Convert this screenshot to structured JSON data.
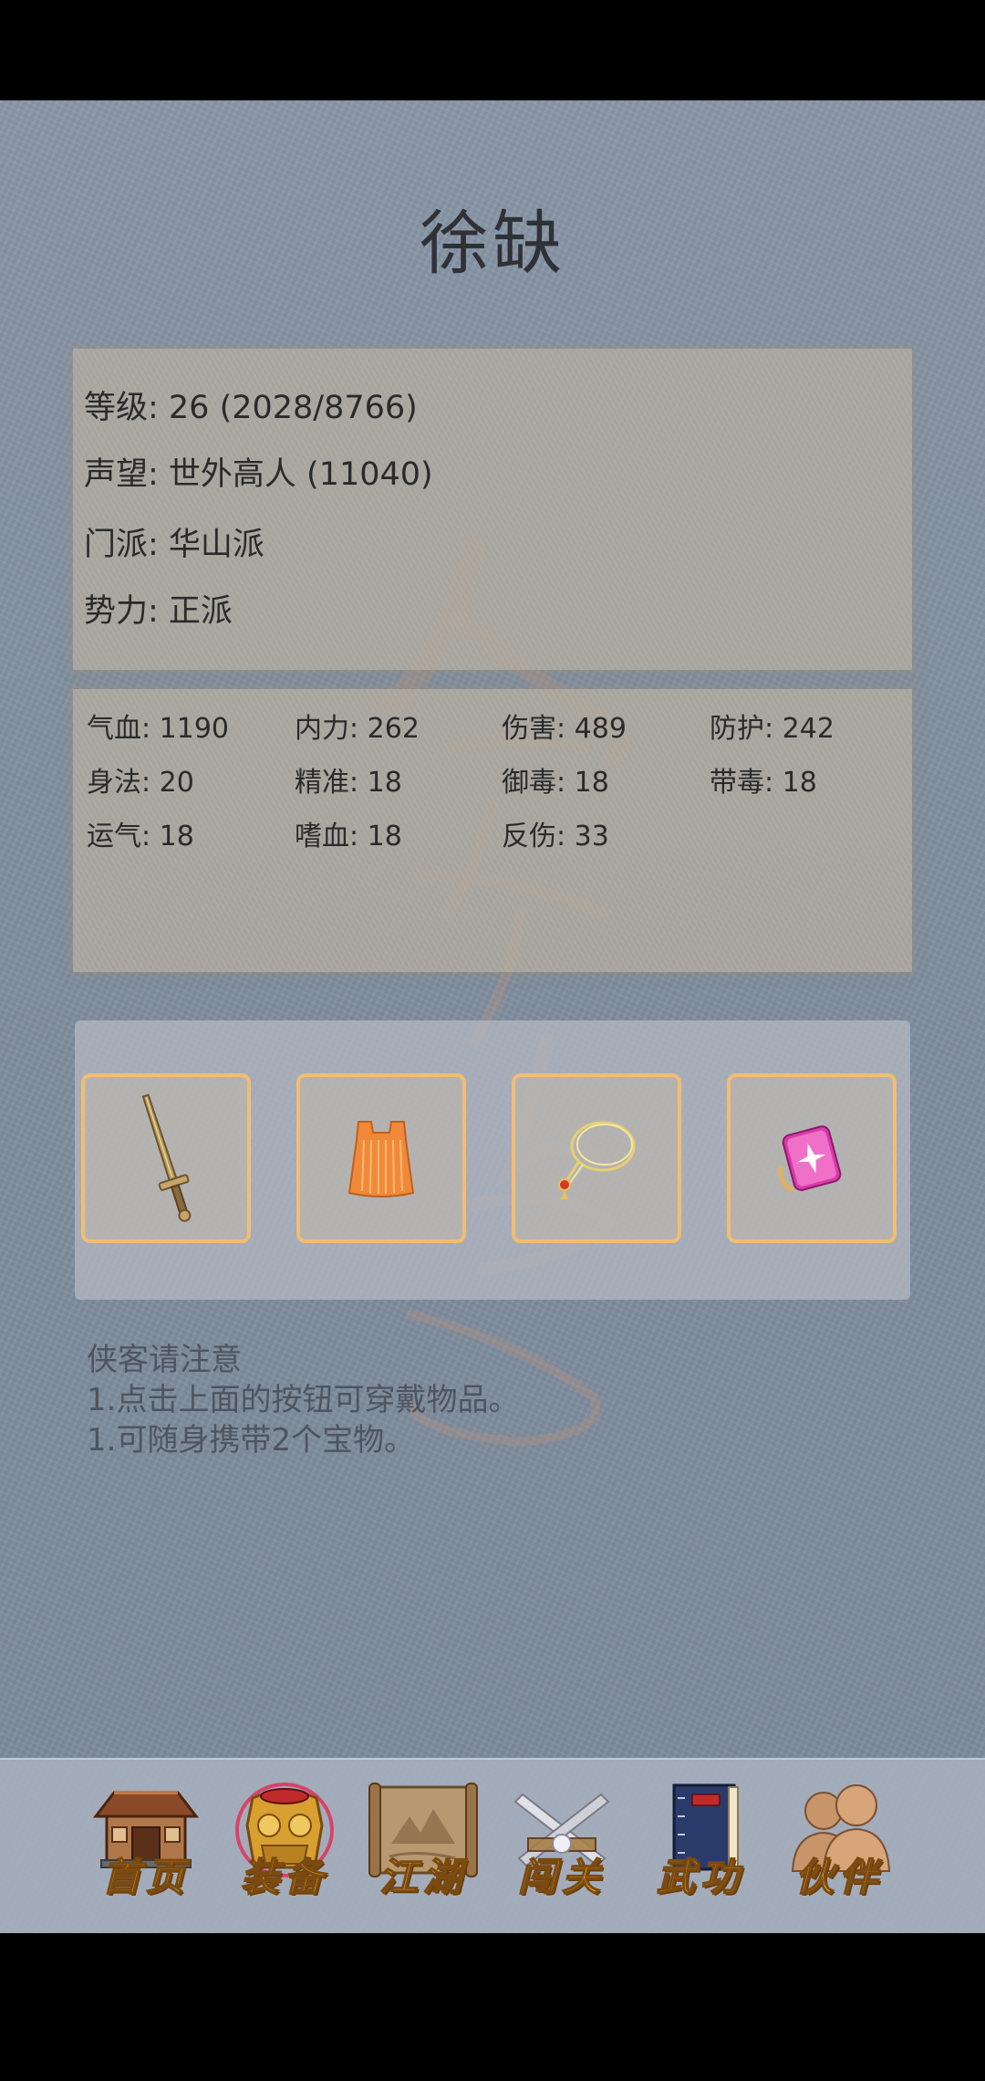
{
  "character": {
    "name": "徐缺"
  },
  "info": {
    "level": "等级: 26 (2028/8766)",
    "reputation": "声望: 世外高人 (11040)",
    "sect": "门派: 华山派",
    "faction": "势力: 正派"
  },
  "stats": [
    {
      "text": "气血: 1190"
    },
    {
      "text": "内力: 262"
    },
    {
      "text": "伤害: 489"
    },
    {
      "text": "防护: 242"
    },
    {
      "text": "身法: 20"
    },
    {
      "text": "精准: 18"
    },
    {
      "text": "御毒: 18"
    },
    {
      "text": "带毒: 18"
    },
    {
      "text": "运气: 18"
    },
    {
      "text": "嗜血: 18"
    },
    {
      "text": "反伤: 33"
    }
  ],
  "equipment": [
    {
      "icon": "sword-icon"
    },
    {
      "icon": "armor-vest-icon"
    },
    {
      "icon": "necklace-icon"
    },
    {
      "icon": "pink-gem-treasure-icon"
    }
  ],
  "notes": {
    "heading": "侠客请注意",
    "line1": "1.点击上面的按钮可穿戴物品。",
    "line2": "1.可随身携带2个宝物。"
  },
  "nav": [
    {
      "label": "首页",
      "icon": "house-icon"
    },
    {
      "label": "装备",
      "icon": "armor-icon",
      "active": true
    },
    {
      "label": "江湖",
      "icon": "map-scroll-icon"
    },
    {
      "label": "闯关",
      "icon": "crossed-swords-icon"
    },
    {
      "label": "武功",
      "icon": "book-icon"
    },
    {
      "label": "伙伴",
      "icon": "people-icon"
    }
  ],
  "colors": {
    "background": "#8290a1",
    "slot_border": "#f2bd72",
    "nav_label": "#f5b82a",
    "active_glow": "#e0305a"
  }
}
